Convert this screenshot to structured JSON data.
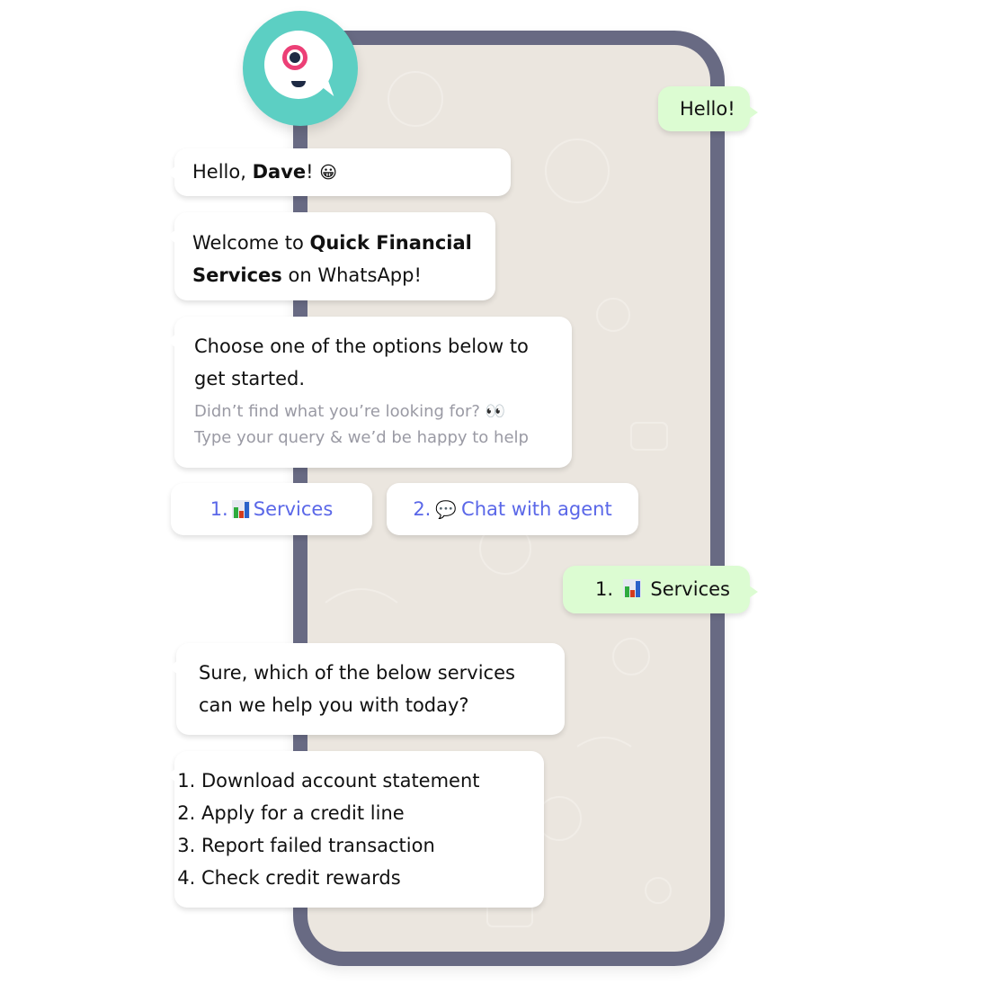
{
  "bot": {
    "avatar": "chatbot-logo"
  },
  "messages": {
    "user_hello": "Hello!",
    "greeting": {
      "pre": "Hello, ",
      "name": "Dave",
      "post": "!",
      "emoji": "😀"
    },
    "welcome": {
      "pre": "Welcome to ",
      "brand": "Quick Financial Services",
      "post": " on WhatsApp!"
    },
    "choose": {
      "text": "Choose one of the options below to get started.",
      "hint_line1": "Didn’t find what you’re looking for? 👀",
      "hint_line2": "Type your query & we’d be happy to help"
    },
    "user_choice": {
      "number": "1.",
      "label": "Services"
    },
    "sure": "Sure, which of the below services can we help you with today?",
    "services_list": [
      "Download account statement",
      "Apply for a credit line",
      "Report failed transaction",
      "Check credit rewards"
    ]
  },
  "quick_replies": [
    {
      "number": "1.",
      "icon": "bar-chart-icon",
      "label": "Services"
    },
    {
      "number": "2.",
      "icon": "speech-bubble-icon",
      "emoji": "💬",
      "label": "Chat with agent"
    }
  ],
  "colors": {
    "frame": "#686a83",
    "chat_bg": "#ebe6df",
    "outgoing_bubble": "#dcfcd2",
    "link_blue": "#5a67e8",
    "avatar_teal": "#5ccfc3",
    "avatar_pink": "#ec3f76"
  }
}
